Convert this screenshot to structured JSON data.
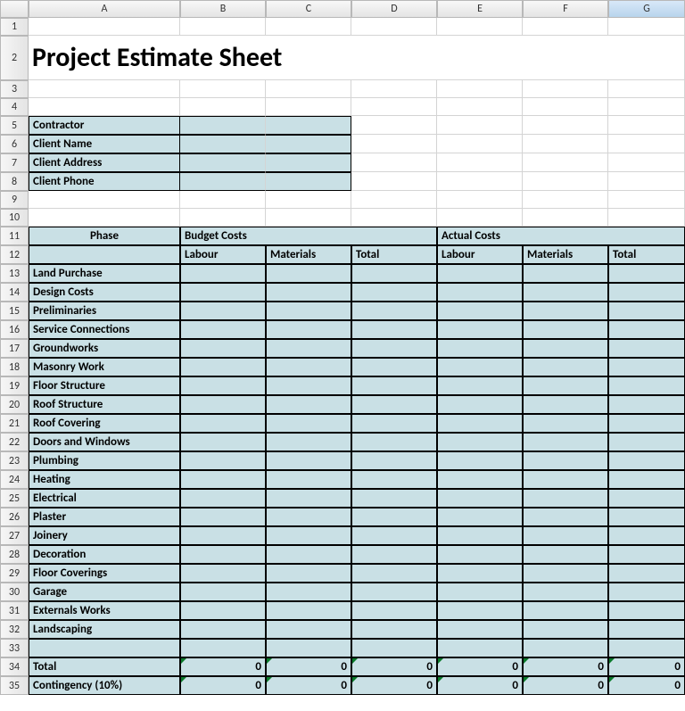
{
  "columns": [
    "A",
    "B",
    "C",
    "D",
    "E",
    "F",
    "G"
  ],
  "title": "Project Estimate Sheet",
  "info_labels": [
    "Contractor",
    "Client Name",
    "Client Address",
    "Client Phone"
  ],
  "headers": {
    "phase": "Phase",
    "budget": "Budget Costs",
    "actual": "Actual Costs",
    "labour": "Labour",
    "materials": "Materials",
    "total": "Total"
  },
  "phases": [
    "Land Purchase",
    "Design Costs",
    "Preliminaries",
    "Service Connections",
    "Groundworks",
    "Masonry Work",
    "Floor Structure",
    "Roof Structure",
    "Roof Covering",
    "Doors and Windows",
    "Plumbing",
    "Heating",
    "Electrical",
    "Plaster",
    "Joinery",
    "Decoration",
    "Floor Coverings",
    "Garage",
    "Externals Works",
    "Landscaping"
  ],
  "totals": {
    "total_label": "Total",
    "contingency_label": "Contingency (10%)",
    "total_values": [
      "0",
      "0",
      "0",
      "0",
      "0",
      "0"
    ],
    "contingency_values": [
      "0",
      "0",
      "0",
      "0",
      "0",
      "0"
    ]
  }
}
